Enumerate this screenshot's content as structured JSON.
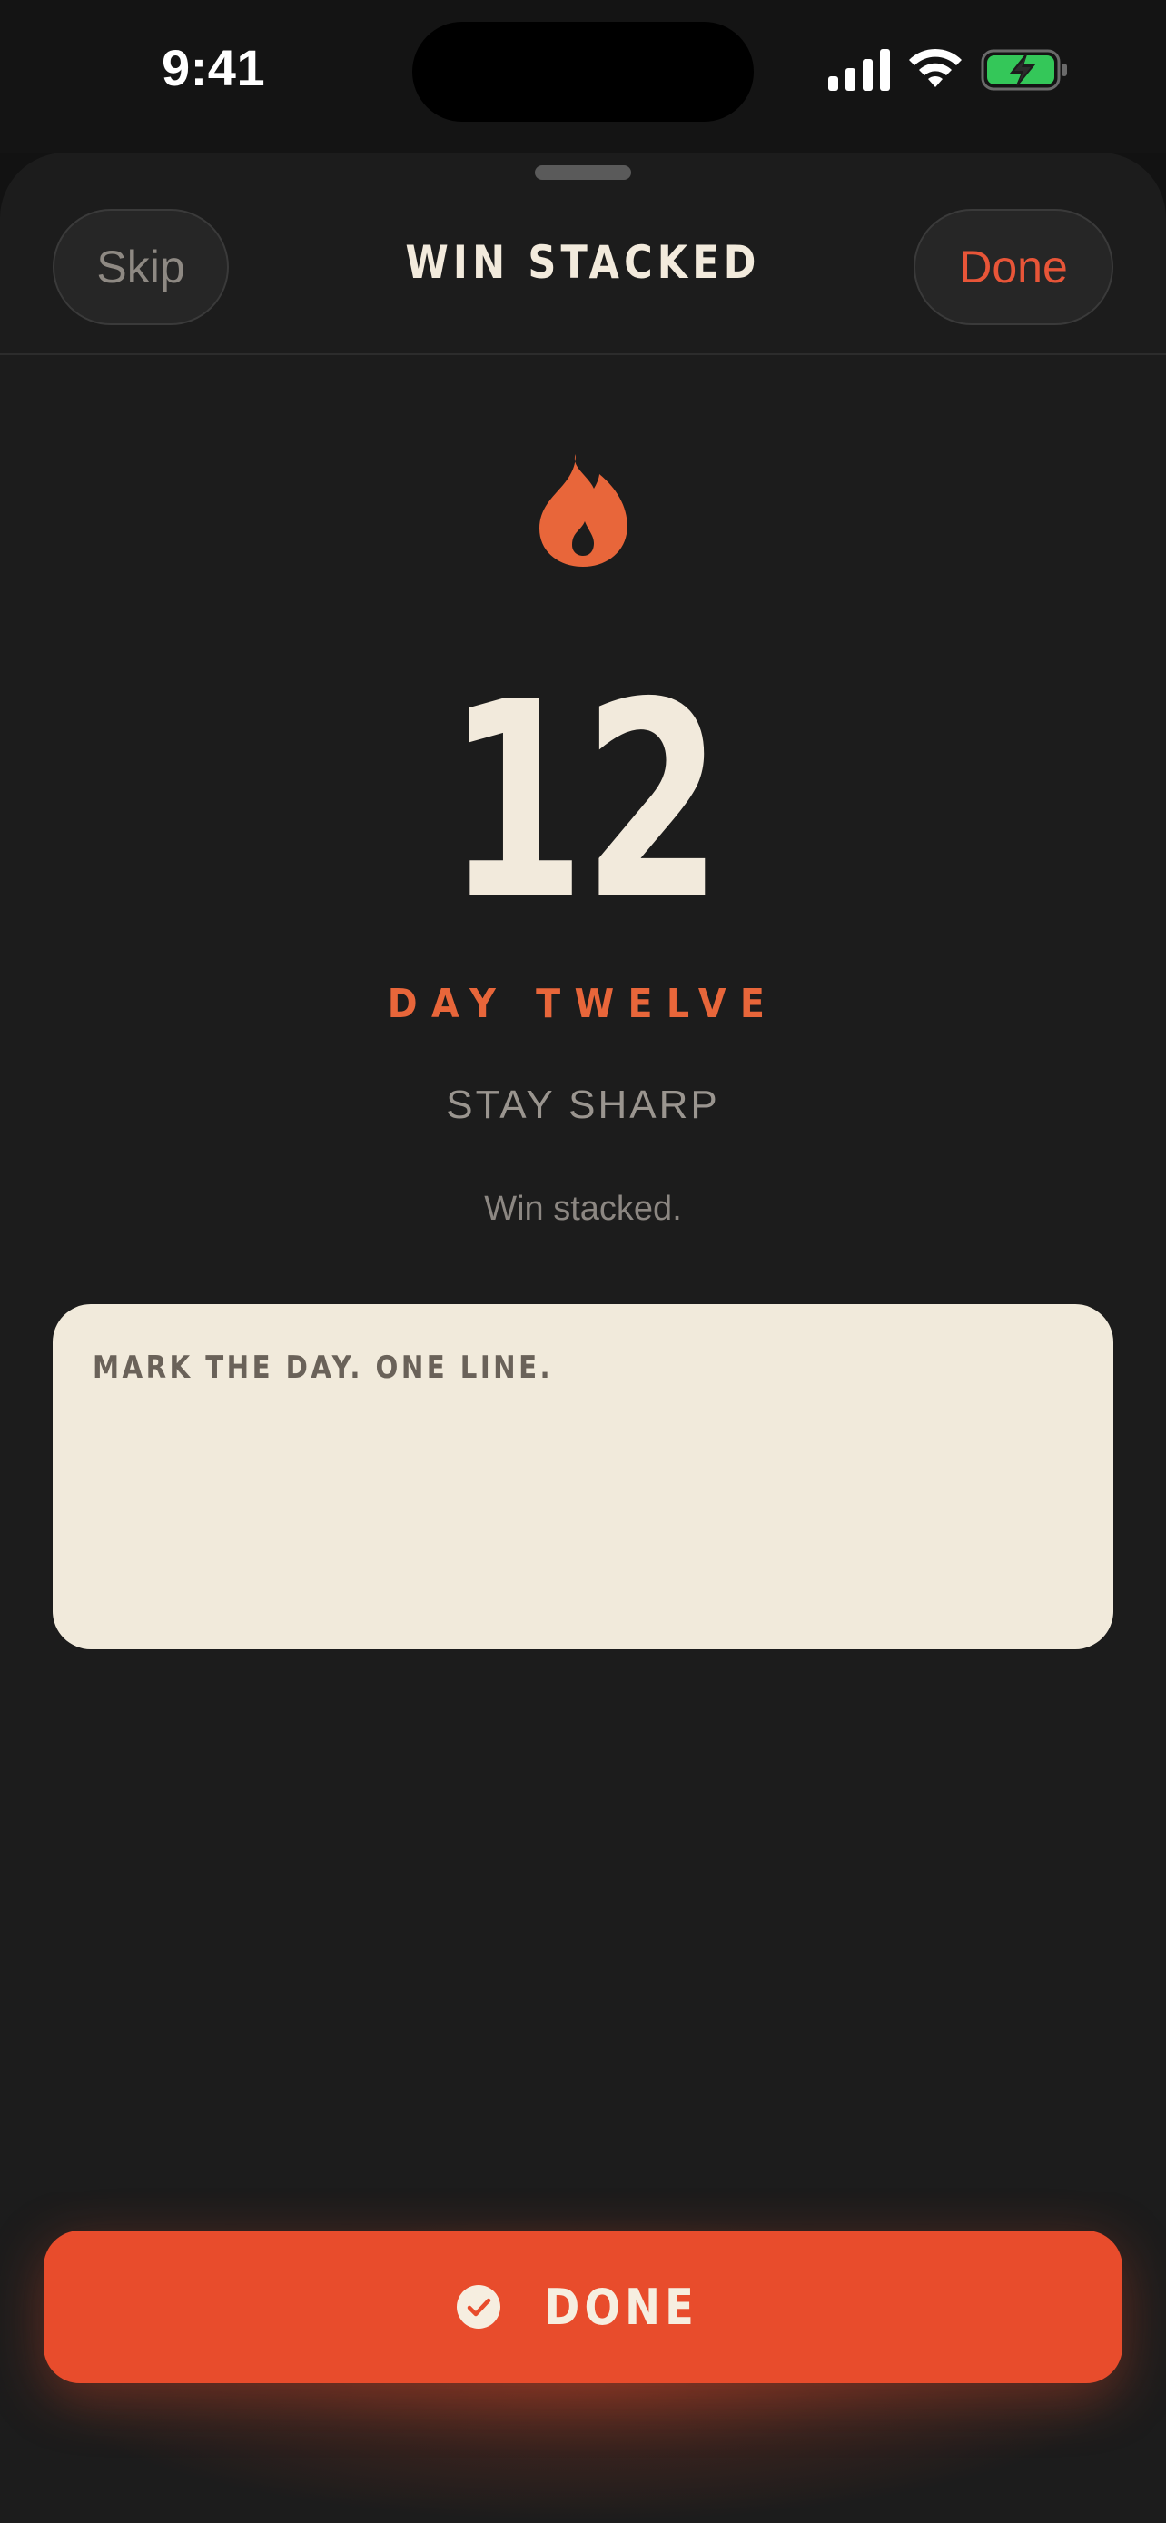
{
  "status_bar": {
    "time": "9:41",
    "battery_color": "#34C759"
  },
  "header": {
    "skip_label": "Skip",
    "title": "WIN STACKED",
    "done_label": "Done"
  },
  "streak": {
    "icon": "flame-icon",
    "number": "12",
    "day_label": "DAY TWELVE",
    "motto": "STAY SHARP",
    "subtext": "Win stacked."
  },
  "note": {
    "placeholder": "MARK THE DAY. ONE LINE.",
    "value": ""
  },
  "cta": {
    "icon": "check-circle-icon",
    "label": "DONE"
  },
  "colors": {
    "accent": "#E84C2C",
    "flame": "#E8663A",
    "cream": "#F2EADC",
    "background": "#1C1C1C"
  }
}
